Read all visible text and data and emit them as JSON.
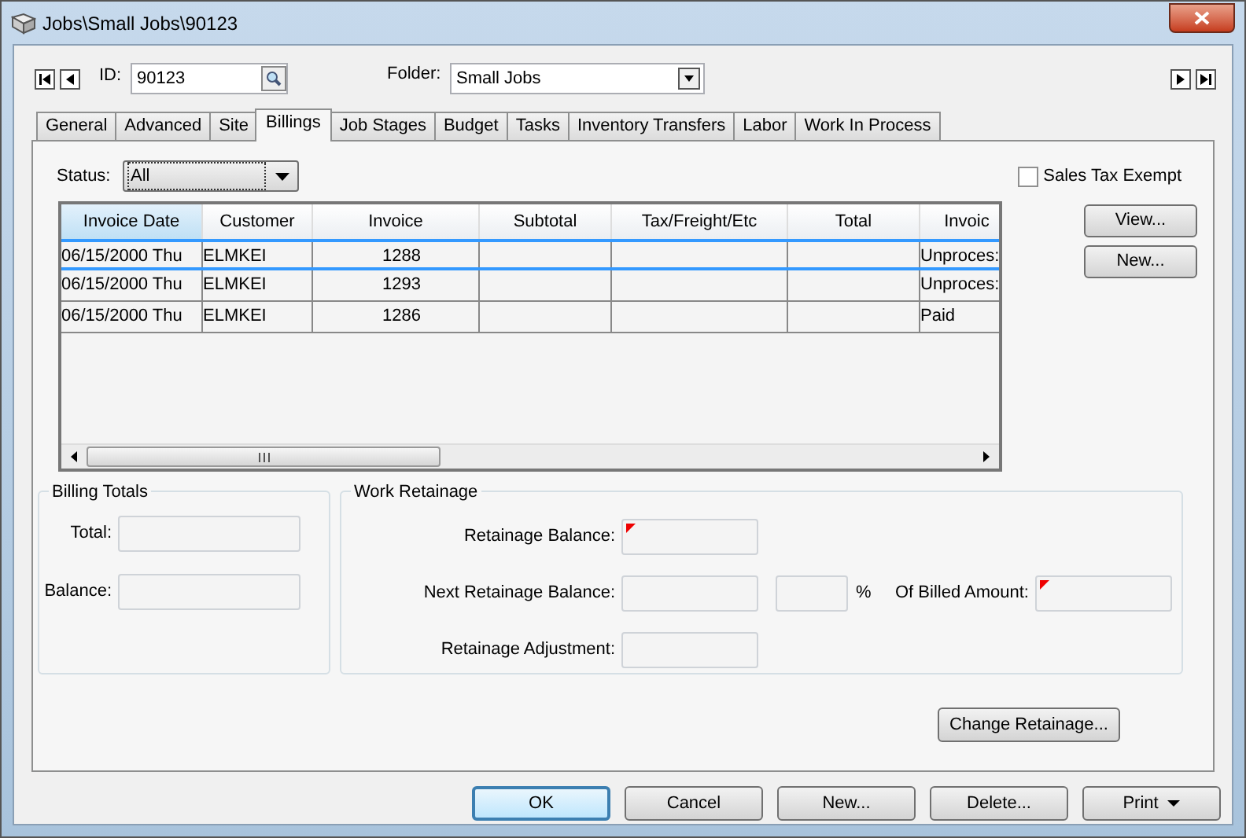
{
  "window": {
    "title": "Jobs\\Small Jobs\\90123"
  },
  "header": {
    "id_label": "ID:",
    "id_value": "90123",
    "folder_label": "Folder:",
    "folder_value": "Small Jobs"
  },
  "tabs": [
    {
      "label": "General",
      "selected": false
    },
    {
      "label": "Advanced",
      "selected": false
    },
    {
      "label": "Site",
      "selected": false
    },
    {
      "label": "Billings",
      "selected": true
    },
    {
      "label": "Job Stages",
      "selected": false
    },
    {
      "label": "Budget",
      "selected": false
    },
    {
      "label": "Tasks",
      "selected": false
    },
    {
      "label": "Inventory Transfers",
      "selected": false
    },
    {
      "label": "Labor",
      "selected": false
    },
    {
      "label": "Work In Process",
      "selected": false
    }
  ],
  "status_filter": {
    "label": "Status:",
    "value": "All"
  },
  "sales_tax_exempt": {
    "label": "Sales Tax Exempt",
    "checked": false
  },
  "table": {
    "columns": [
      {
        "label": "Invoice Date",
        "sorted": true
      },
      {
        "label": "Customer",
        "sorted": false
      },
      {
        "label": "Invoice",
        "sorted": false
      },
      {
        "label": "Subtotal",
        "sorted": false
      },
      {
        "label": "Tax/Freight/Etc",
        "sorted": false
      },
      {
        "label": "Total",
        "sorted": false
      },
      {
        "label": "Invoic",
        "sorted": false
      }
    ],
    "rows": [
      {
        "cells": [
          "06/15/2000 Thu",
          "ELMKEI",
          "1288",
          "",
          "",
          "",
          "Unproces:"
        ],
        "selected": true
      },
      {
        "cells": [
          "06/15/2000 Thu",
          "ELMKEI",
          "1293",
          "",
          "",
          "",
          "Unproces:"
        ],
        "selected": false
      },
      {
        "cells": [
          "06/15/2000 Thu",
          "ELMKEI",
          "1286",
          "",
          "",
          "",
          "Paid"
        ],
        "selected": false
      }
    ]
  },
  "side_buttons": [
    "View...",
    "New..."
  ],
  "billing_totals": {
    "title": "Billing Totals",
    "fields": [
      {
        "label": "Total:"
      },
      {
        "label": "Balance:"
      }
    ]
  },
  "work_retainage": {
    "title": "Work Retainage",
    "rows": [
      [
        {
          "kind": "field",
          "label": "Retainage Balance:",
          "flagged": true
        }
      ],
      [
        {
          "kind": "field",
          "label": "Next Retainage Balance:",
          "flagged": false
        },
        {
          "kind": "percent",
          "label": "%",
          "flagged": false
        },
        {
          "kind": "field",
          "label": "Of Billed Amount:",
          "flagged": true
        }
      ],
      [
        {
          "kind": "field",
          "label": "Retainage Adjustment:",
          "flagged": false
        }
      ]
    ]
  },
  "change_button": "Change Retainage...",
  "footer_buttons": [
    {
      "label": "OK",
      "default": true,
      "menu": false
    },
    {
      "label": "Cancel",
      "default": false,
      "menu": false
    },
    {
      "label": "New...",
      "default": false,
      "menu": false
    },
    {
      "label": "Delete...",
      "default": false,
      "menu": false
    },
    {
      "label": "Print",
      "default": false,
      "menu": true
    }
  ]
}
